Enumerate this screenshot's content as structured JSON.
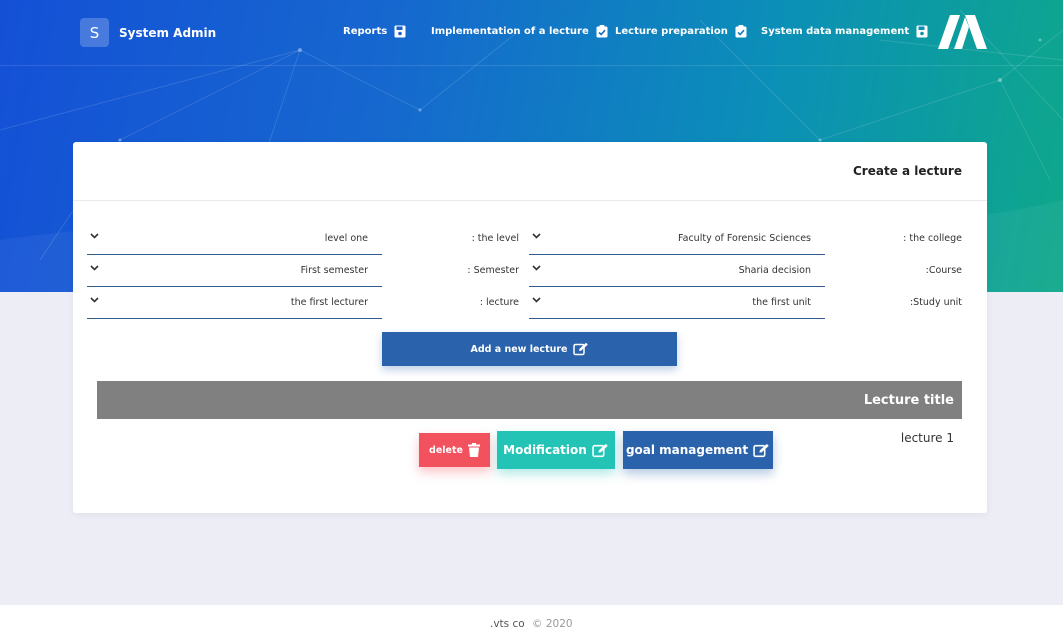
{
  "header": {
    "brand_initial": "S",
    "brand_title": "System Admin",
    "nav": [
      {
        "label": "Reports",
        "icon": "save-icon"
      },
      {
        "label": "Implementation of a lecture",
        "icon": "clipboard-check-icon"
      },
      {
        "label": "Lecture preparation",
        "icon": "clipboard-check-icon"
      },
      {
        "label": "System data management",
        "icon": "save-icon"
      }
    ],
    "logo_icon": "brand-logo-icon"
  },
  "card": {
    "title": "Create a lecture",
    "fields": {
      "level": {
        "label": ": the level",
        "value": "level one"
      },
      "college": {
        "label": ": the college",
        "value": "Faculty of Forensic Sciences"
      },
      "semester": {
        "label": ": Semester",
        "value": "First semester"
      },
      "course": {
        "label": ":Course",
        "value": "Sharia decision"
      },
      "lecturer": {
        "label": ": lecture",
        "value": "the first lecturer"
      },
      "study_unit": {
        "label": ":Study unit",
        "value": "the first unit"
      }
    },
    "add_button": "Add a new lecture",
    "table": {
      "header": "Lecture title",
      "rows": [
        {
          "title": "lecture 1",
          "delete": "delete",
          "modify": "Modification",
          "goal": "goal management"
        }
      ]
    }
  },
  "footer": {
    "company": ".vts co",
    "copyright": "© 2020"
  },
  "colors": {
    "primary": "#2a63ab",
    "danger": "#f1525e",
    "teal": "#23c4b6",
    "table_header": "#808080"
  }
}
